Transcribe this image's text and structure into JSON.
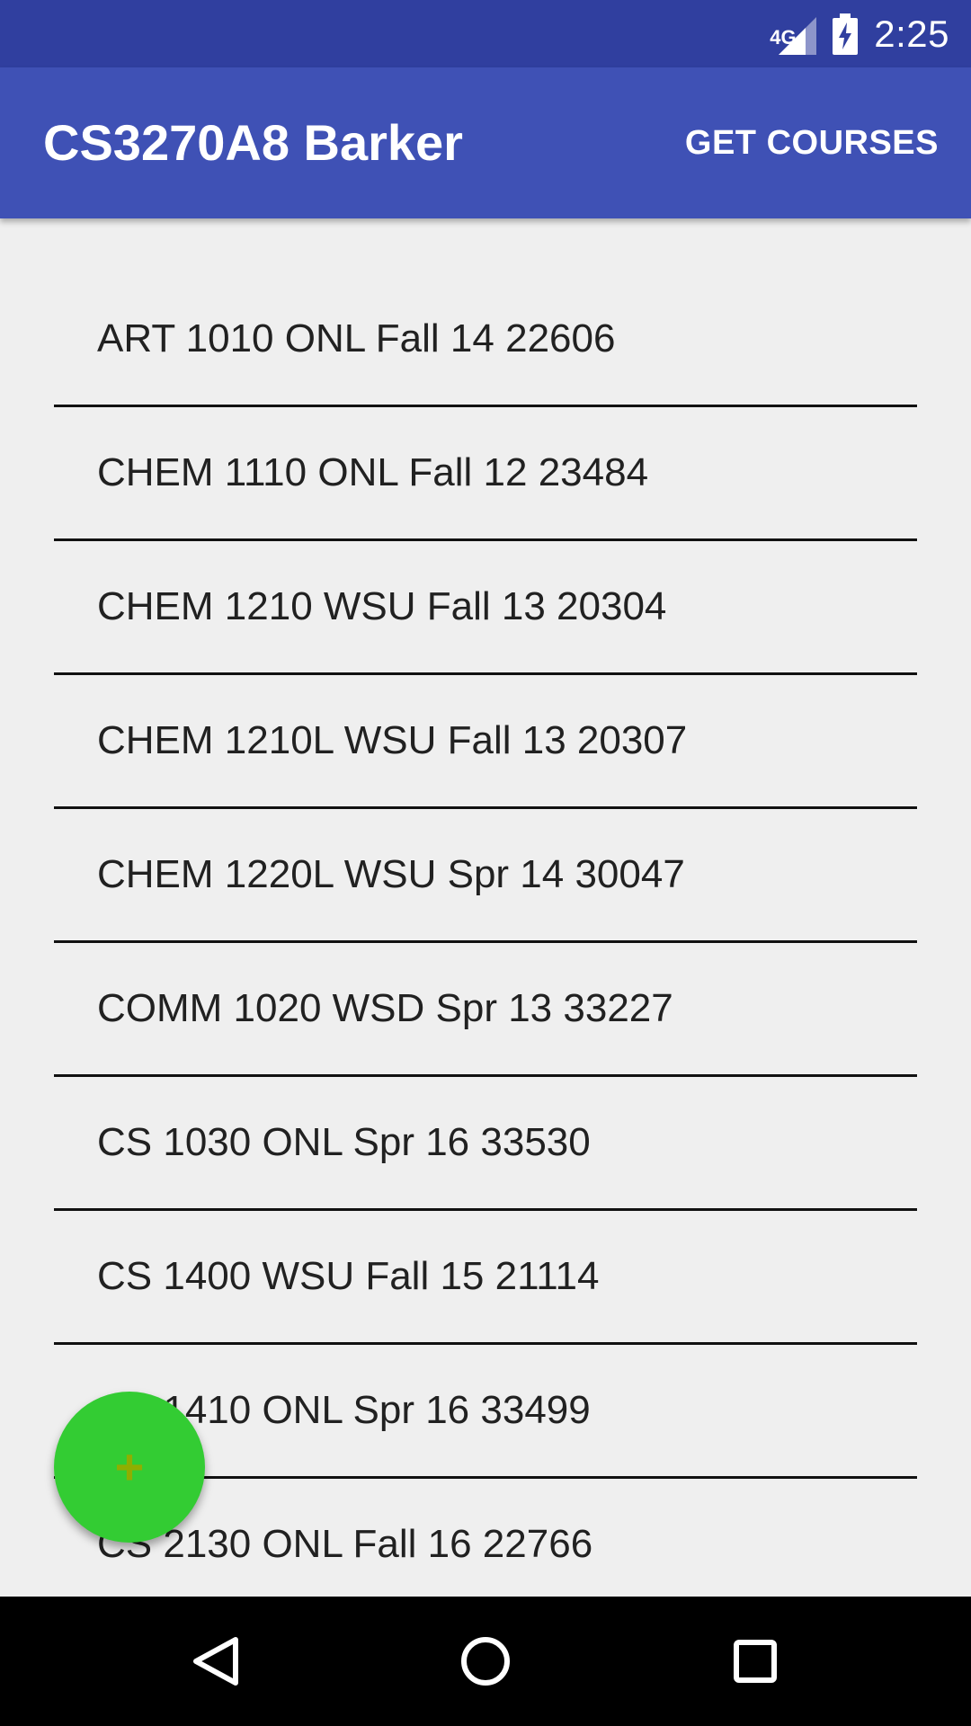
{
  "status_bar": {
    "network": "4G",
    "time": "2:25"
  },
  "app_bar": {
    "title": "CS3270A8 Barker",
    "action_label": "GET COURSES"
  },
  "courses": [
    "ART 1010 ONL Fall 14 22606",
    "CHEM 1110 ONL Fall 12 23484",
    "CHEM 1210 WSU Fall 13 20304",
    "CHEM 1210L WSU Fall 13 20307",
    "CHEM 1220L WSU Spr 14 30047",
    "COMM 1020 WSD Spr 13 33227",
    "CS 1030 ONL Spr 16 33530",
    "CS 1400 WSU Fall 15 21114",
    "CS 1410 ONL Spr 16 33499",
    "CS 2130 ONL Fall 16 22766"
  ],
  "fab": {
    "icon": "plus-icon",
    "symbol": "+"
  },
  "nav_bar": {
    "back_icon": "back-triangle-icon",
    "home_icon": "home-circle-icon",
    "recents_icon": "recents-square-icon"
  },
  "colors": {
    "status_bar": "#303f9f",
    "app_bar": "#3f51b5",
    "background": "#efefef",
    "fab": "#33cc33",
    "fab_plus": "#8fae00"
  }
}
